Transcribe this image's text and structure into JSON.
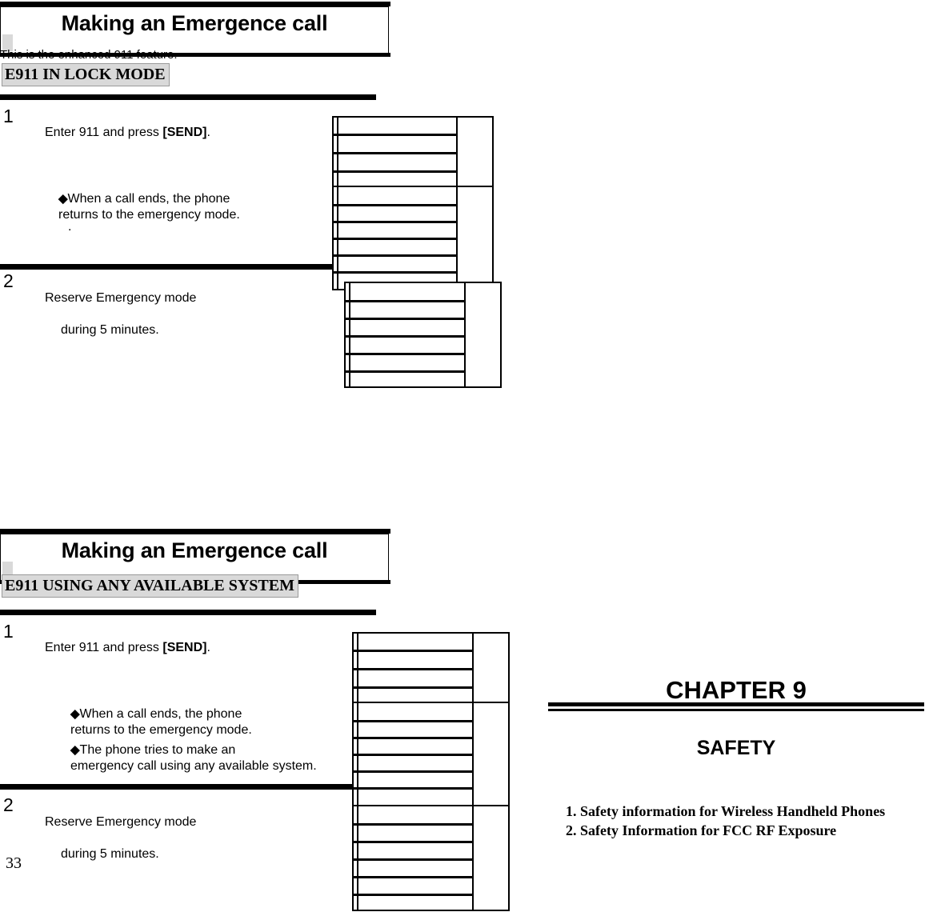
{
  "page": {
    "page_number": "33"
  },
  "sections": [
    {
      "title": "Making an Emergence call",
      "caption": "This is the enhanced 911 feature.",
      "subheading": "E911 IN LOCK MODE",
      "steps": [
        {
          "number": "1",
          "text": "Enter 911 and press ",
          "bold": "[SEND]",
          "tail": "."
        },
        {
          "number": "2",
          "line1": "Reserve Emergency mode",
          "line2": "during 5 minutes."
        }
      ],
      "notes": [
        {
          "bullet": "diamond-question-glyph",
          "line1": "When a call ends, the phone",
          "line2": "returns to the emergency mode."
        }
      ],
      "stray_dot": "."
    },
    {
      "title": "Making an Emergence call",
      "caption": "",
      "subheading": "E911 USING ANY AVAILABLE SYSTEM",
      "steps": [
        {
          "number": "1",
          "text": "Enter 911 and press ",
          "bold": "[SEND]",
          "tail": "."
        },
        {
          "number": "2",
          "line1": "Reserve Emergency mode",
          "line2": "during 5 minutes."
        }
      ],
      "notes": [
        {
          "bullet": "diamond-question-glyph",
          "line1": "When a call ends, the phone",
          "line2": "returns to the emergency mode."
        },
        {
          "bullet": "diamond-question-glyph",
          "line1": "The phone tries to make an",
          "line2": "emergency call using any available system."
        }
      ]
    }
  ],
  "chapter": {
    "title": "CHAPTER 9",
    "subtitle": "SAFETY",
    "items": [
      "1. Safety information for Wireless Handheld Phones",
      "2. Safety Information for FCC RF Exposure"
    ]
  },
  "glyphs": {
    "missing_char": "◆"
  },
  "colors": {
    "ink": "#000000",
    "highlight": "#d9d9d9",
    "paper": "#ffffff"
  }
}
